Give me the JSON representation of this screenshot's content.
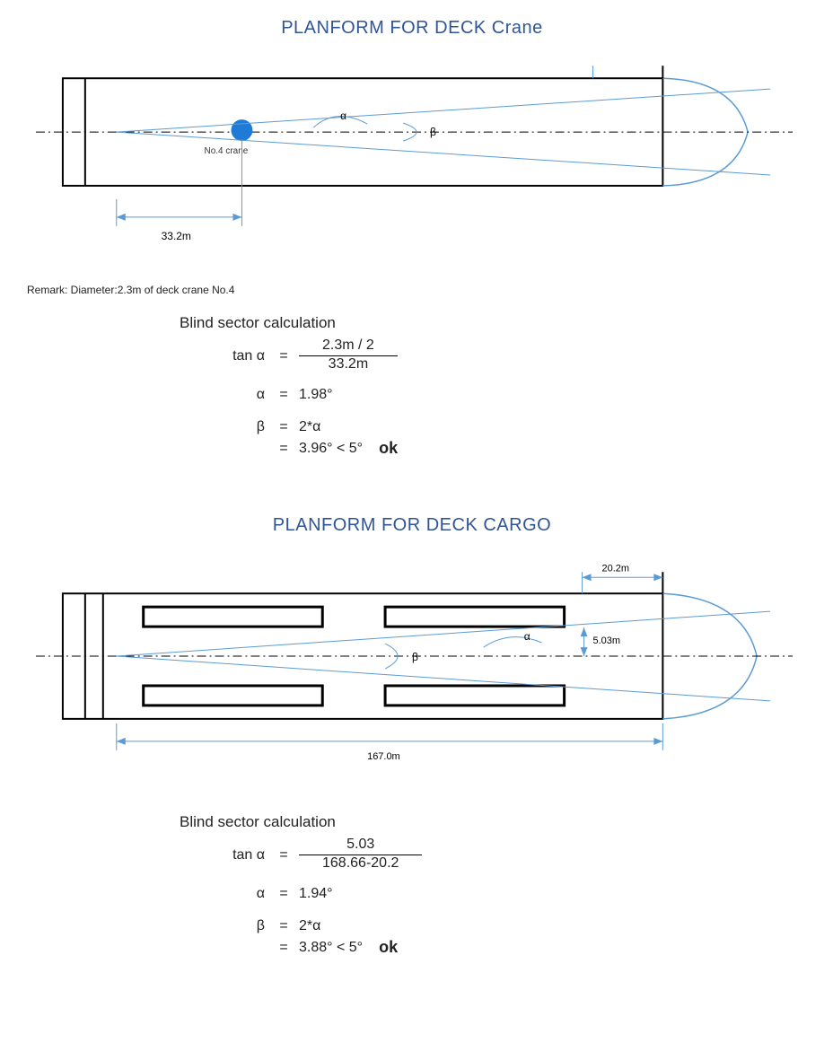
{
  "section1": {
    "title": "PLANFORM FOR DECK Crane",
    "diagram": {
      "crane_label": "No.4 crane",
      "alpha_label": "α",
      "beta_label": "β",
      "dim_label": "33.2m"
    },
    "remark": "Remark: Diameter:2.3m of deck crane No.4",
    "calc": {
      "title": "Blind sector calculation",
      "tan_lhs": "tan α",
      "frac_num": "2.3m / 2",
      "frac_den": "33.2m",
      "alpha_lhs": "α",
      "alpha_val": "1.98°",
      "beta_lhs": "β",
      "beta_expr": "2*α",
      "beta_val": "3.96° < 5°",
      "ok": "ok"
    }
  },
  "section2": {
    "title": "PLANFORM FOR DECK CARGO",
    "diagram": {
      "alpha_label": "α",
      "beta_label": "β",
      "dim_top": "20.2m",
      "dim_side": "5.03m",
      "dim_bottom": "167.0m"
    },
    "calc": {
      "title": "Blind sector calculation",
      "tan_lhs": "tan α",
      "frac_num": "5.03",
      "frac_den": "168.66-20.2",
      "alpha_lhs": "α",
      "alpha_val": "1.94°",
      "beta_lhs": "β",
      "beta_expr": "2*α",
      "beta_val": "3.88° < 5°",
      "ok": "ok"
    }
  },
  "chart_data": [
    {
      "type": "diagram",
      "name": "Deck crane blind sector planform",
      "crane_diameter_m": 2.3,
      "crane_distance_m": 33.2,
      "alpha_deg": 1.98,
      "beta_deg": 3.96,
      "limit_deg": 5,
      "result": "ok"
    },
    {
      "type": "diagram",
      "name": "Deck cargo blind sector planform",
      "cargo_offset_m": 5.03,
      "length_total_m": 168.66,
      "length_to_bow_m": 20.2,
      "length_display_m": 167.0,
      "alpha_deg": 1.94,
      "beta_deg": 3.88,
      "limit_deg": 5,
      "result": "ok"
    }
  ]
}
